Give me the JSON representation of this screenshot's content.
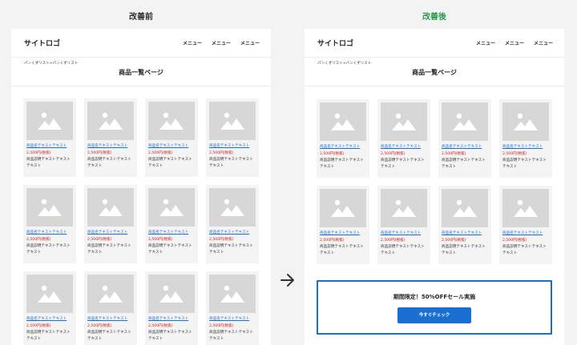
{
  "labels": {
    "before": "改善前",
    "after": "改善後"
  },
  "colors": {
    "after_label": "#2a9d4a",
    "link": "#1a6fd1",
    "price": "#d21a1a"
  },
  "site": {
    "logo": "サイトロゴ",
    "nav": [
      "メニュー",
      "メニュー",
      "メニュー"
    ],
    "breadcrumb": "パンくずリスト>パンくずリスト",
    "page_title": "商品一覧ページ"
  },
  "product": {
    "name": "商品名テキストテキスト",
    "price": "2,500円(税抜)",
    "desc": "商品説明テキストテキストテキスト"
  },
  "sale": {
    "title": "期間限定！50%OFFセール実施",
    "button": "今すぐチェック"
  },
  "icons": {
    "thumb": "image-placeholder-icon",
    "arrow": "arrow-right-icon"
  }
}
